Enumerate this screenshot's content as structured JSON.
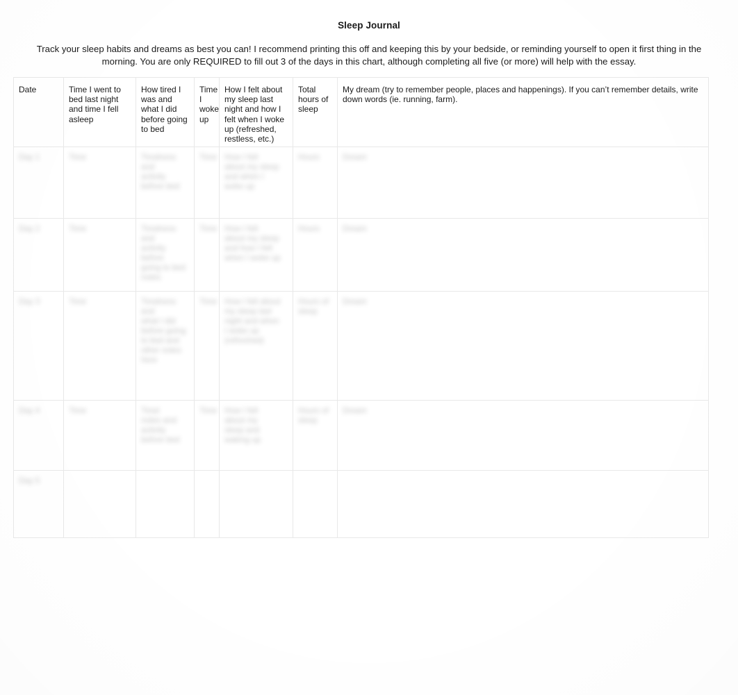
{
  "document": {
    "title": "Sleep Journal",
    "intro": "Track your sleep habits and dreams as best you can! I recommend printing this off and keeping this by your bedside, or reminding yourself to open it first thing in the morning. You are only REQUIRED to fill out 3 of the days in this chart, although completing all five (or more) will help with the essay."
  },
  "table": {
    "headers": [
      "Date",
      "Time I went to bed last night and time I fell asleep",
      "How tired I was and what I did before going to bed",
      "Time I woke up",
      "How I felt about my sleep last night and how I felt when I woke up (refreshed, restless, etc.)",
      "Total hours of sleep",
      "My dream (try to remember people, places and happenings). If you can’t remember details, write down words (ie. running, farm)."
    ],
    "rows": [
      {
        "date": "Day 1",
        "bedtime": "Time",
        "tired": "Tiredness and\nactivity\nbefore bed",
        "woke": "Time",
        "felt": "How I felt\nabout my sleep\nand when I\nwoke up",
        "hours": "Hours",
        "dream": "Dream"
      },
      {
        "date": "Day 2",
        "bedtime": "Time",
        "tired": "Tiredness and\nactivity before\ngoing to bed\nnotes",
        "woke": "Time",
        "felt": "How I felt\nabout my sleep\nand how I felt\nwhen I woke up",
        "hours": "Hours",
        "dream": "Dream"
      },
      {
        "date": "Day 3",
        "bedtime": "Time",
        "tired": "Tiredness and\nwhat I did\nbefore going\nto bed and\nother notes\nhere",
        "woke": "Time",
        "felt": "How I felt about\nmy sleep last\nnight and when\nI woke up\n(refreshed)",
        "hours": "Hours of\nsleep",
        "dream": "Dream"
      },
      {
        "date": "Day 4",
        "bedtime": "Time",
        "tired": "Tired\nnotes and\nactivity\nbefore bed",
        "woke": "Time",
        "felt": "How I felt\nabout my\nsleep and\nwaking up",
        "hours": "Hours of\nsleep",
        "dream": "Dream"
      },
      {
        "date": "Day 5",
        "bedtime": "",
        "tired": "",
        "woke": "",
        "felt": "",
        "hours": "",
        "dream": ""
      }
    ]
  }
}
